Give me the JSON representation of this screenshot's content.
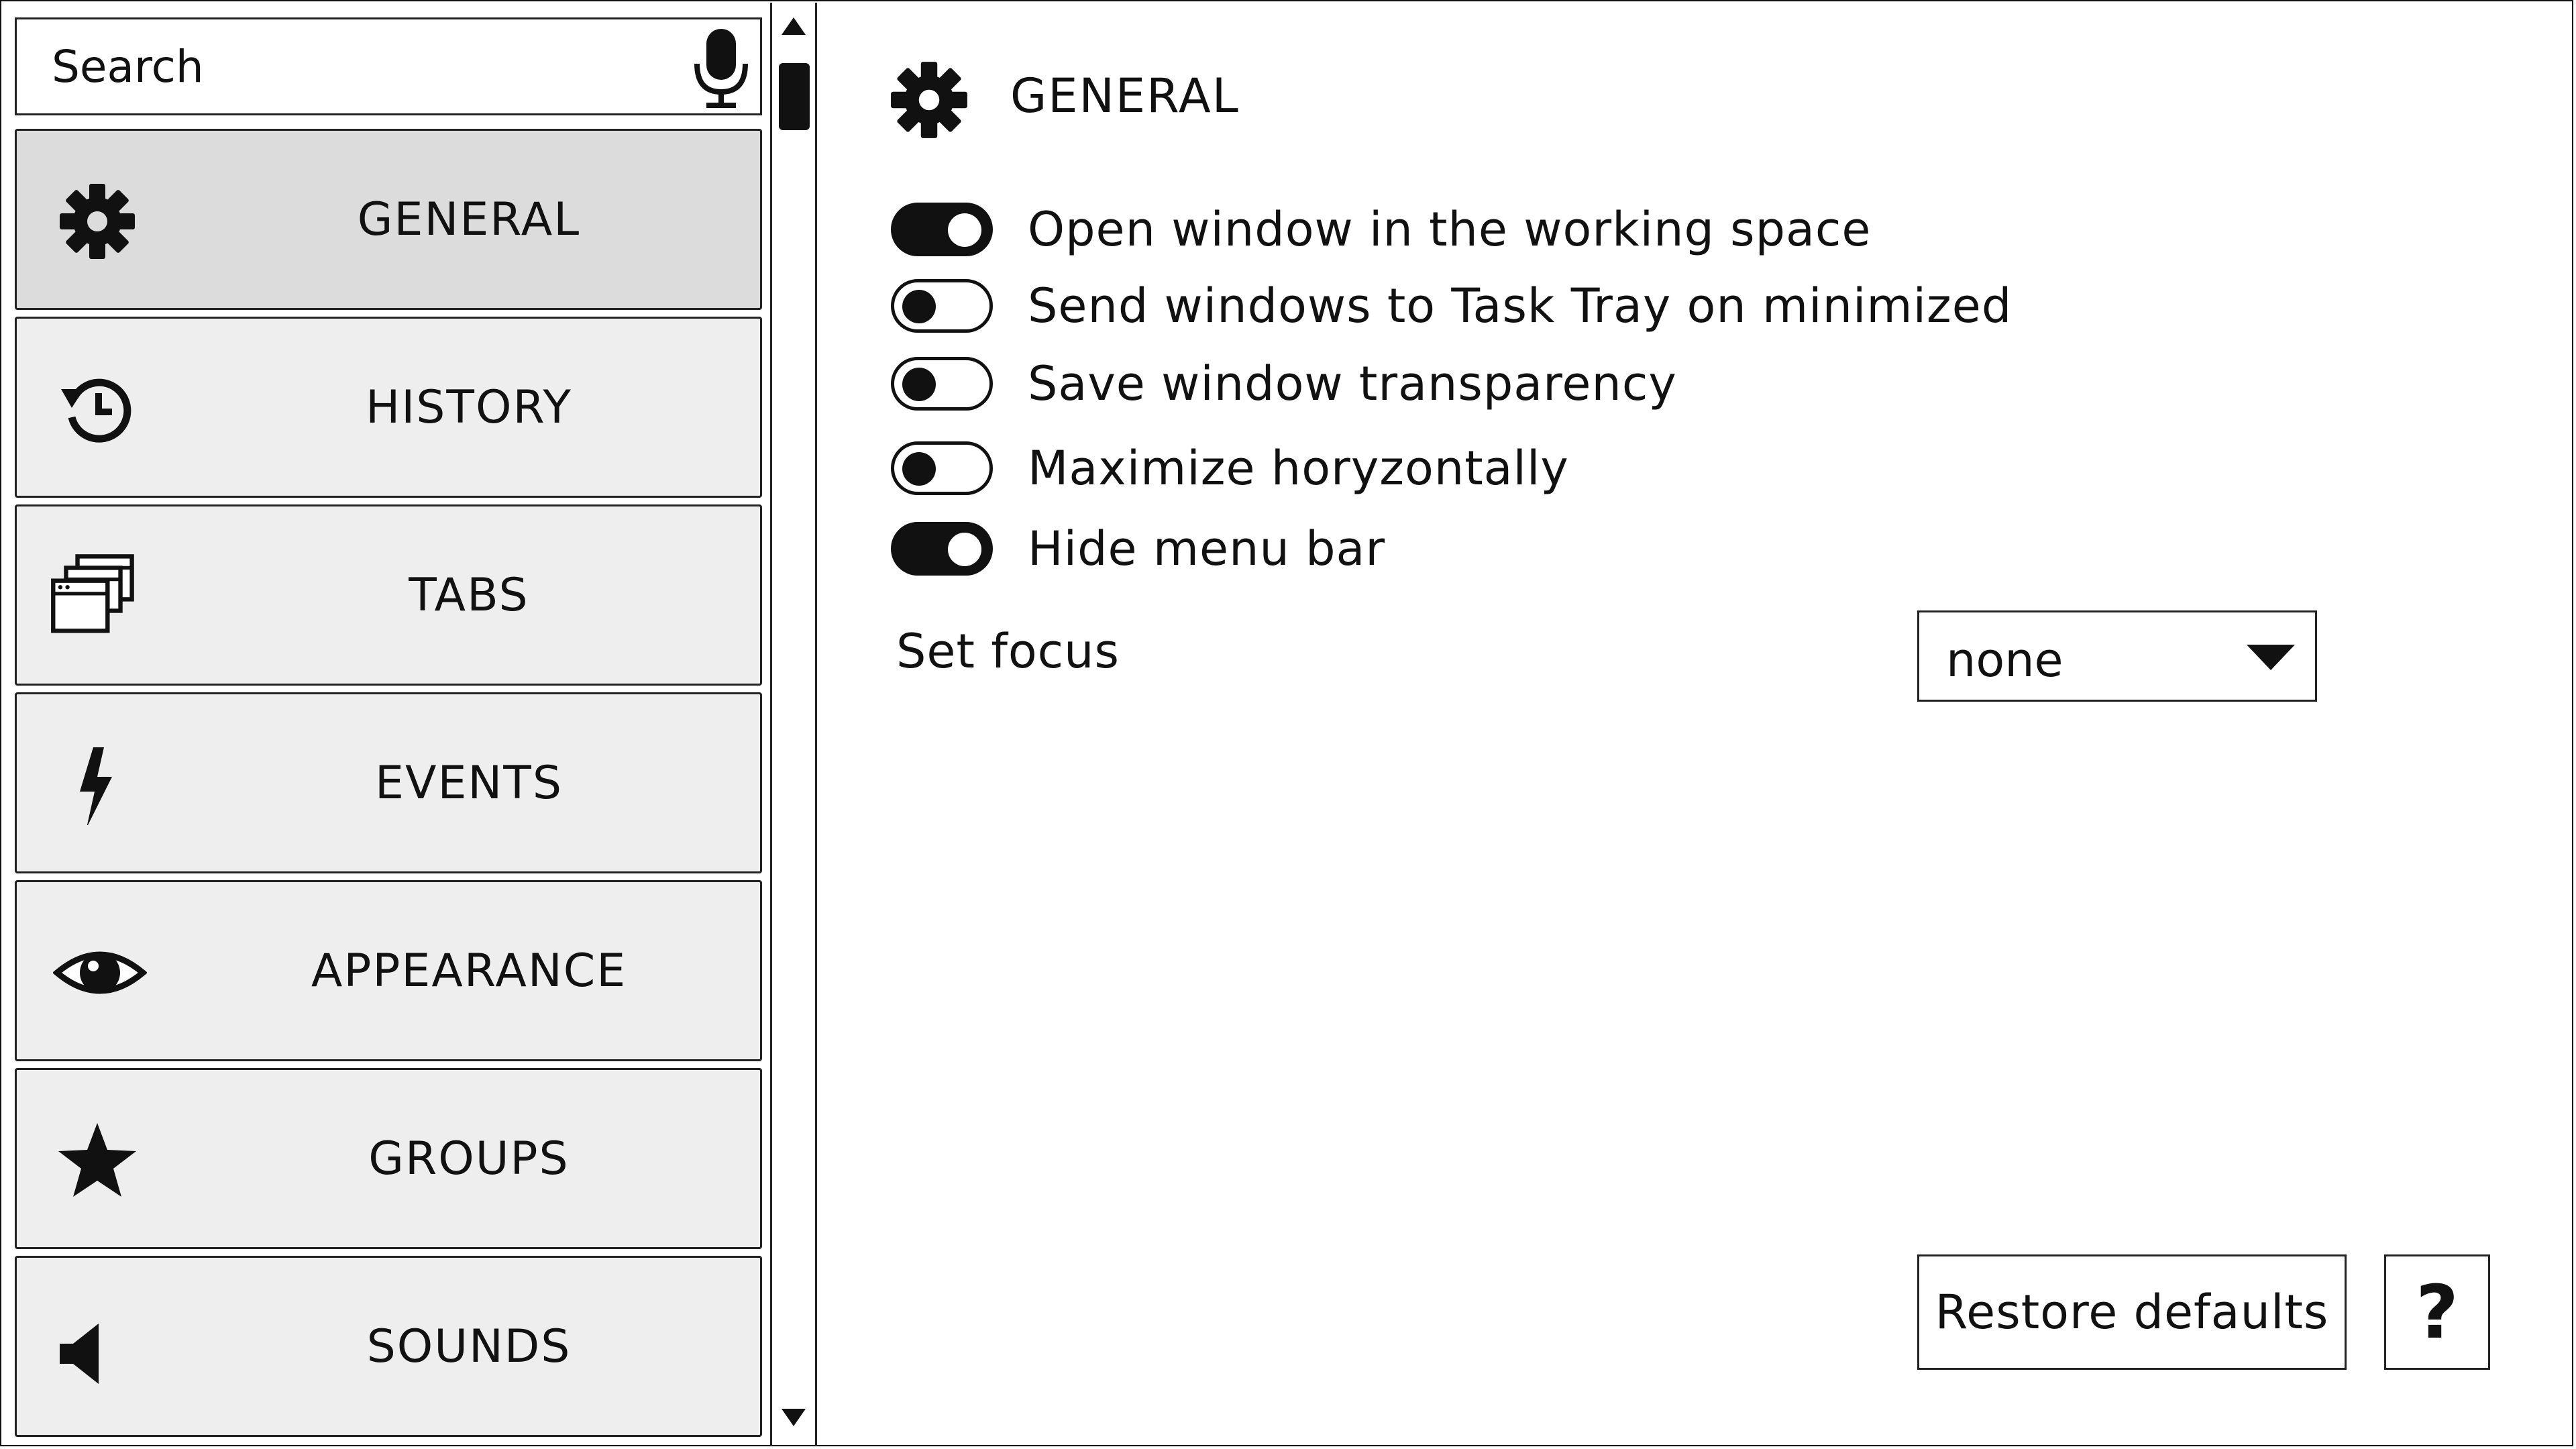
{
  "search": {
    "placeholder": "Search",
    "icon": "microphone-icon"
  },
  "sidebar": {
    "items": [
      {
        "label": "GENERAL",
        "icon": "gear-icon",
        "active": true
      },
      {
        "label": "HISTORY",
        "icon": "history-icon",
        "active": false
      },
      {
        "label": "TABS",
        "icon": "tabs-icon",
        "active": false
      },
      {
        "label": "EVENTS",
        "icon": "lightning-icon",
        "active": false
      },
      {
        "label": "APPEARANCE",
        "icon": "eye-icon",
        "active": false
      },
      {
        "label": "GROUPS",
        "icon": "star-icon",
        "active": false
      },
      {
        "label": "SOUNDS",
        "icon": "speaker-icon",
        "active": false
      }
    ]
  },
  "main": {
    "title": "GENERAL",
    "toggles": [
      {
        "label": "Open window in the working space",
        "on": true
      },
      {
        "label": "Send windows to Task Tray on minimized",
        "on": false
      },
      {
        "label": "Save window transparency",
        "on": false
      },
      {
        "label": "Maximize horyzontally",
        "on": false
      },
      {
        "label": "Hide menu bar",
        "on": true
      }
    ],
    "focus": {
      "label": "Set focus",
      "value": "none"
    },
    "restore_label": "Restore defaults",
    "help_label": "?"
  }
}
